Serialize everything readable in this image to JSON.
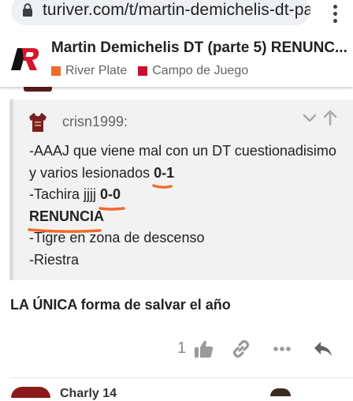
{
  "browser": {
    "url": "turiver.com/t/martin-demichelis-dt-parte-"
  },
  "topic": {
    "title": "Martin Demichelis DT (parte 5) RENUNC...",
    "categories": [
      {
        "label": "River Plate",
        "color": "#f06b2c"
      },
      {
        "label": "Campo de Juego",
        "color": "#c8102e"
      }
    ]
  },
  "quote": {
    "username": "crisn1999:",
    "lines": [
      {
        "text": "-AAAJ que viene mal con un DT cuestionadisimo"
      },
      {
        "text": "y varios lesionados ",
        "score": "0-1"
      },
      {
        "text": "-Tachira jjjj ",
        "score": "0-0"
      },
      {
        "text": "",
        "score": "RENUNCIA"
      },
      {
        "text": "-Tigre en zona de descenso"
      },
      {
        "text": "-Riestra"
      }
    ]
  },
  "post": {
    "reply_text": "LA ÚNICA forma de salvar el año",
    "like_count": "1"
  },
  "next_post": {
    "username": "Charly 14"
  },
  "colors": {
    "accent_orange": "#f06b2c",
    "brand_red": "#c8102e"
  }
}
